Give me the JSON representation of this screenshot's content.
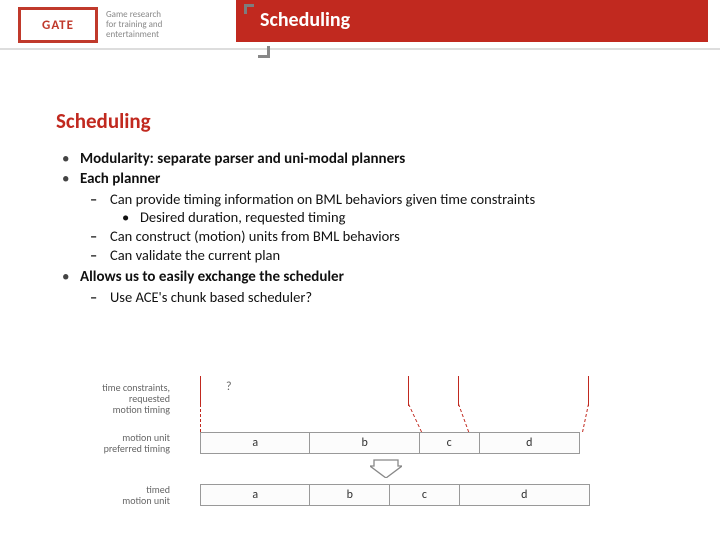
{
  "logo": {
    "text": "GATE",
    "tagline1": "Game research",
    "tagline2": "for training and",
    "tagline3": "entertainment"
  },
  "banner_title": "Scheduling",
  "section_title": "Scheduling",
  "bullets": {
    "b1": "Modularity: separate parser and uni-modal planners",
    "b2": "Each planner",
    "b2_sub1": "Can provide timing information on BML behaviors given time constraints",
    "b2_sub1_a": "Desired duration, requested timing",
    "b2_sub2": "Can construct (motion) units from BML behaviors",
    "b2_sub3": "Can validate the current plan",
    "b3": "Allows us to easily exchange the scheduler",
    "b3_sub1": "Use ACE's chunk based scheduler?"
  },
  "diagram": {
    "label1a": "time constraints,",
    "label1b": "requested",
    "label1c": "motion timing",
    "label2a": "motion unit",
    "label2b": "preferred timing",
    "label3a": "timed",
    "label3b": "motion unit",
    "qmark": "?",
    "segs_top": [
      "a",
      "b",
      "c",
      "d"
    ],
    "segs_bot": [
      "a",
      "b",
      "c",
      "d"
    ]
  }
}
